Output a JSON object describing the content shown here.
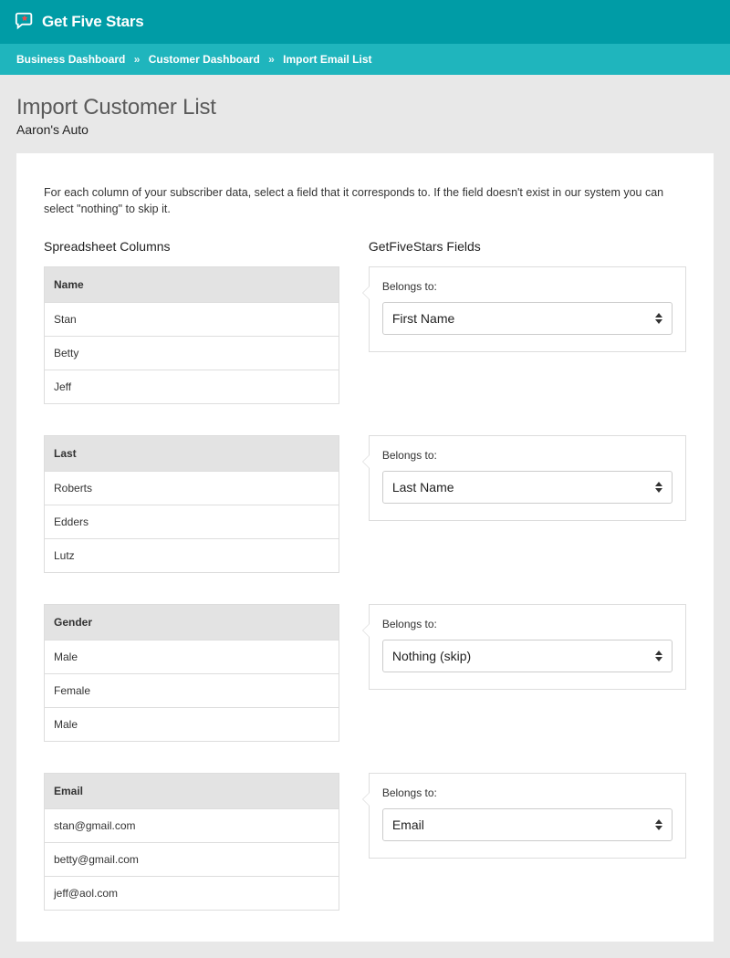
{
  "brand": {
    "name": "Get Five Stars"
  },
  "breadcrumbs": {
    "items": [
      {
        "label": "Business Dashboard"
      },
      {
        "label": "Customer Dashboard"
      },
      {
        "label": "Import Email List"
      }
    ],
    "separator": "»"
  },
  "page": {
    "title": "Import Customer List",
    "subtitle": "Aaron's Auto"
  },
  "instructions": "For each column of your subscriber data, select a field that it corresponds to.  If the field doesn't exist in our system you can select \"nothing\" to skip it.",
  "headers": {
    "left": "Spreadsheet Columns",
    "right": "GetFiveStars Fields"
  },
  "belongs_label": "Belongs to:",
  "columns": [
    {
      "name": "Name",
      "samples": [
        "Stan",
        "Betty",
        "Jeff"
      ],
      "mapped_to": "First Name"
    },
    {
      "name": "Last",
      "samples": [
        "Roberts",
        "Edders",
        "Lutz"
      ],
      "mapped_to": "Last Name"
    },
    {
      "name": "Gender",
      "samples": [
        "Male",
        "Female",
        "Male"
      ],
      "mapped_to": "Nothing (skip)"
    },
    {
      "name": "Email",
      "samples": [
        "stan@gmail.com",
        "betty@gmail.com",
        "jeff@aol.com"
      ],
      "mapped_to": "Email"
    }
  ]
}
